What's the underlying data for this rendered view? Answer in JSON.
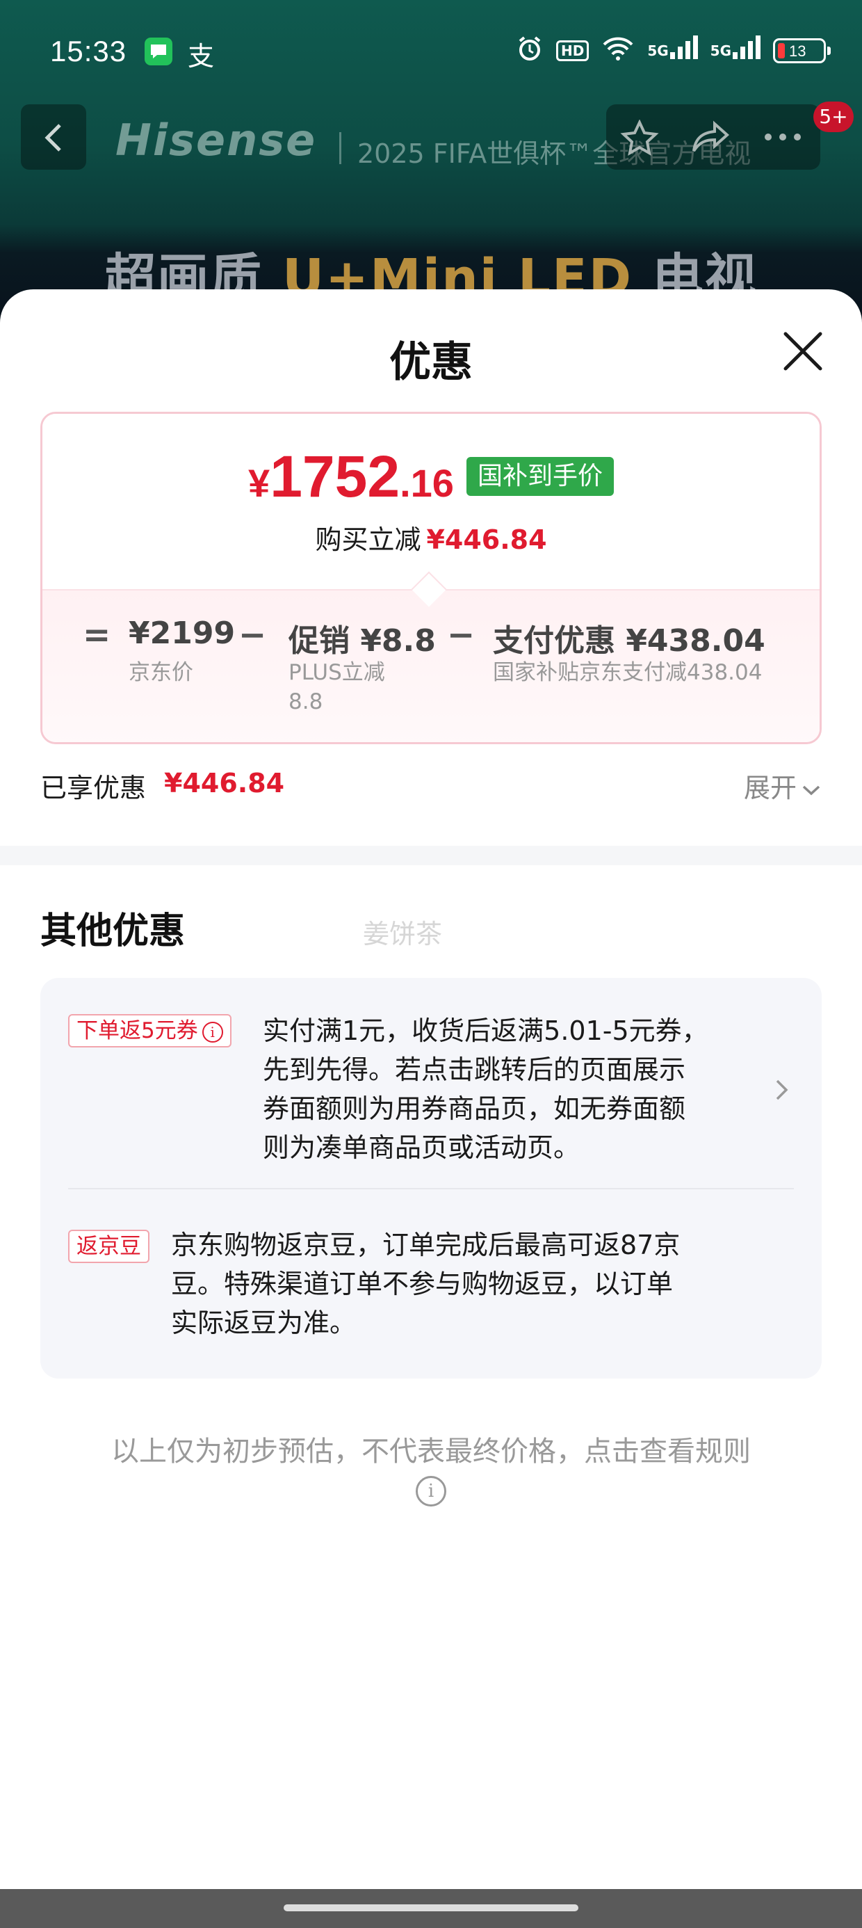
{
  "status_bar": {
    "time": "15:33",
    "app2_glyph": "支",
    "hd_label": "HD",
    "signal1_label": "5G",
    "signal2_label": "5G",
    "battery": "13"
  },
  "background_page": {
    "brand": "Hisense",
    "brand_tag": "2025 FIFA世俱杯™全球官方电视",
    "cart_badge": "5+",
    "headline_prefix": "超画质 ",
    "headline_accent": "U+Mini LED",
    "headline_suffix": " 电视"
  },
  "sheet": {
    "title": "优惠",
    "price": {
      "currency": "¥",
      "integer": "1752",
      "decimal": ".16",
      "tag": "国补到手价",
      "sub_label": "购买立减",
      "sub_value": "¥446.84"
    },
    "breakdown": {
      "eq": "=",
      "minus1": "−",
      "minus2": "−",
      "jd_price_value": "¥2199",
      "jd_price_label": "京东价",
      "promo_value": "促销 ¥8.8",
      "promo_label_line1": "PLUS立减",
      "promo_label_line2": "8.8",
      "pay_value": "支付优惠 ¥438.04",
      "pay_label": "国家补贴京东支付减438.04"
    },
    "enjoyed": {
      "label": "已享优惠",
      "value": "¥446.84",
      "expand": "展开"
    },
    "other": {
      "title": "其他优惠",
      "watermark": "姜饼茶",
      "offers": [
        {
          "tag": "下单返5元券",
          "lines": [
            "实付满1元，收货后返满5.01-5元券，",
            "先到先得。若点击跳转后的页面展示",
            "券面额则为用券商品页，如无券面额",
            "则为凑单商品页或活动页。"
          ]
        },
        {
          "tag": "返京豆",
          "lines": [
            "京东购物返京豆，订单完成后最高可返87京",
            "豆。特殊渠道订单不参与购物返豆，以订单",
            "实际返豆为准。"
          ]
        }
      ]
    },
    "footnote": "以上仅为初步预估，不代表最终价格，点击查看规则"
  },
  "colors": {
    "price_red": "#e01b2f",
    "tag_green": "#2fa84a",
    "card_border": "#f6c9d2",
    "other_card_bg": "#f5f6fa"
  }
}
